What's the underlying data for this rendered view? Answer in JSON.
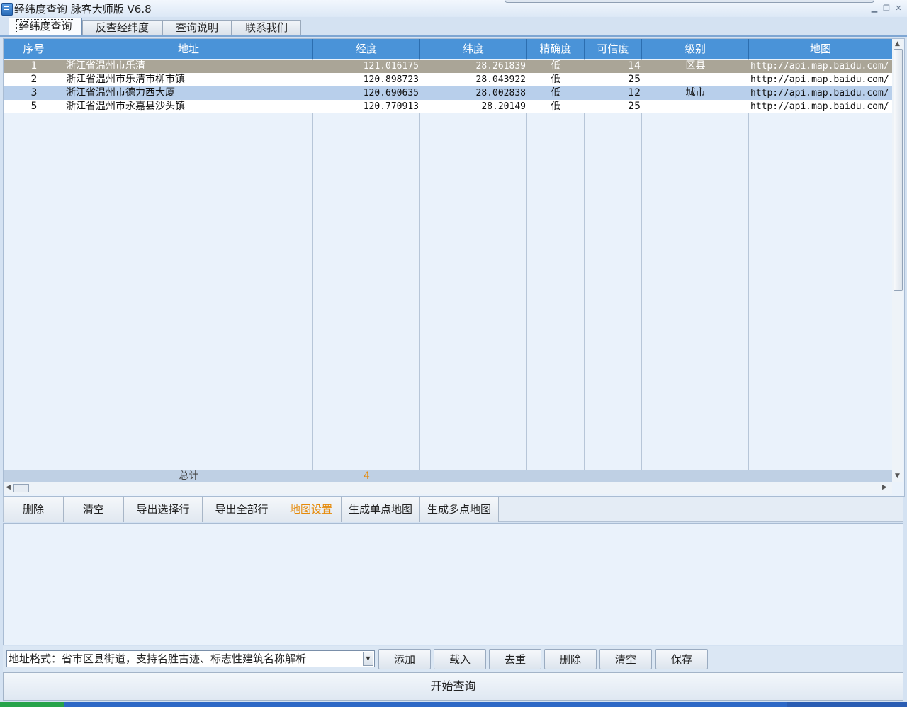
{
  "window": {
    "title": "经纬度查询 脉客大师版 V6.8"
  },
  "tabs": [
    "经纬度查询",
    "反查经纬度",
    "查询说明",
    "联系我们"
  ],
  "grid": {
    "columns": [
      "序号",
      "地址",
      "经度",
      "纬度",
      "精确度",
      "可信度",
      "级别",
      "地图"
    ],
    "rows": [
      {
        "seq": "1",
        "address": "浙江省温州市乐清",
        "lng": "121.016175",
        "lat": "28.261839",
        "precision": "低",
        "confidence": "14",
        "level": "区县",
        "map": "http://api.map.baidu.com/"
      },
      {
        "seq": "2",
        "address": "浙江省温州市乐清市柳市镇",
        "lng": "120.898723",
        "lat": "28.043922",
        "precision": "低",
        "confidence": "25",
        "level": "",
        "map": "http://api.map.baidu.com/"
      },
      {
        "seq": "3",
        "address": "浙江省温州市德力西大厦",
        "lng": "120.690635",
        "lat": "28.002838",
        "precision": "低",
        "confidence": "12",
        "level": "城市",
        "map": "http://api.map.baidu.com/"
      },
      {
        "seq": "5",
        "address": "浙江省温州市永嘉县沙头镇",
        "lng": "120.770913",
        "lat": "28.20149",
        "precision": "低",
        "confidence": "25",
        "level": "",
        "map": "http://api.map.baidu.com/"
      }
    ],
    "totals": {
      "label": "总计",
      "count": "4"
    }
  },
  "toolbar": [
    "删除",
    "清空",
    "导出选择行",
    "导出全部行",
    "地图设置",
    "生成单点地图",
    "生成多点地图"
  ],
  "bottom": {
    "input_value": "地址格式：省市区县街道，支持名胜古迹、标志性建筑名称解析",
    "buttons": [
      "添加",
      "载入",
      "去重",
      "删除",
      "清空",
      "保存"
    ]
  },
  "start_label": "开始查询",
  "colors": {
    "header": "#4a93d8",
    "selected_row": "#aaa597",
    "alt_row": "#b8cfeb",
    "accent_text": "#e58a0a"
  }
}
